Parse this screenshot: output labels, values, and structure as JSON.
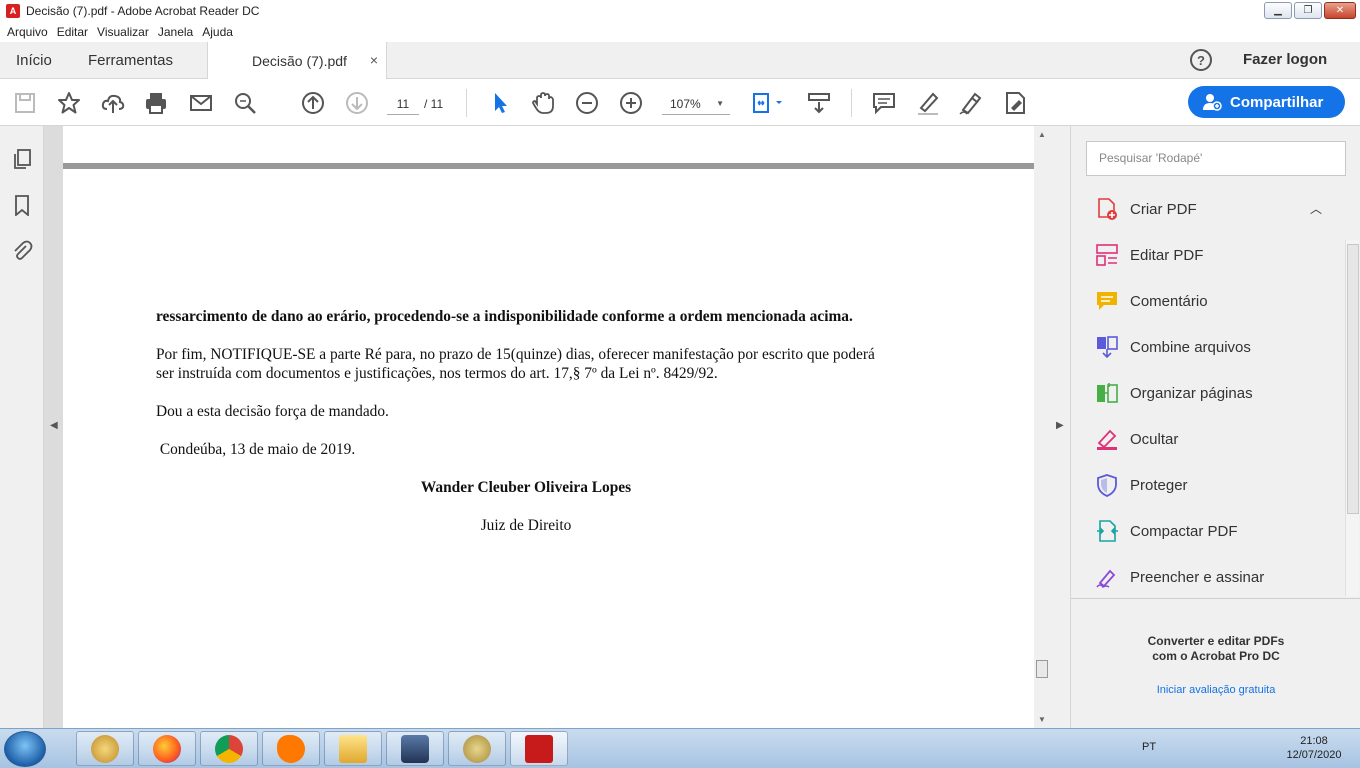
{
  "window": {
    "title": "Decisão (7).pdf - Adobe Acrobat Reader DC",
    "min": "▁",
    "max": "❐",
    "close": "✕"
  },
  "menu": [
    "Arquivo",
    "Editar",
    "Visualizar",
    "Janela",
    "Ajuda"
  ],
  "tabs": {
    "home": "Início",
    "tools": "Ferramentas",
    "doc": "Decisão (7).pdf",
    "close": "×"
  },
  "account": {
    "help": "?",
    "login": "Fazer logon"
  },
  "toolbar": {
    "page_current": "11",
    "page_total": "/ 11",
    "zoom": "107%",
    "share": "Compartilhar"
  },
  "document": {
    "p1": "ressarcimento de dano ao erário, procedendo-se a indisponibilidade conforme a ordem mencionada acima.",
    "p2": "Por fim, NOTIFIQUE-SE a parte Ré para, no prazo de 15(quinze) dias, oferecer manifestação por escrito que poderá ser instruída com documentos e justificações, nos termos do art. 17,§ 7º da Lei nº. 8429/92.",
    "p3": "Dou a esta decisão força de mandado.",
    "p4": " Condeúba, 13 de maio de 2019.",
    "signer": "Wander Cleuber Oliveira Lopes",
    "role": "Juiz de Direito"
  },
  "right_panel": {
    "search_placeholder": "Pesquisar 'Rodapé'",
    "tools": [
      {
        "label": "Criar PDF",
        "icon": "create-pdf-icon",
        "color": "#e03e3e"
      },
      {
        "label": "Editar PDF",
        "icon": "edit-pdf-icon",
        "color": "#e0307a"
      },
      {
        "label": "Comentário",
        "icon": "comment-icon",
        "color": "#f0b400"
      },
      {
        "label": "Combine arquivos",
        "icon": "combine-files-icon",
        "color": "#5a5adb"
      },
      {
        "label": "Organizar páginas",
        "icon": "organize-pages-icon",
        "color": "#46b046"
      },
      {
        "label": "Ocultar",
        "icon": "redact-icon",
        "color": "#e0307a"
      },
      {
        "label": "Proteger",
        "icon": "protect-icon",
        "color": "#5a5adb"
      },
      {
        "label": "Compactar PDF",
        "icon": "compress-pdf-icon",
        "color": "#1aa3a3"
      },
      {
        "label": "Preencher e assinar",
        "icon": "fill-sign-icon",
        "color": "#8a4cd6"
      }
    ],
    "promo_line1": "Converter e editar PDFs",
    "promo_line2": "com o Acrobat Pro DC",
    "trial": "Iniciar avaliação gratuita"
  },
  "taskbar": {
    "lang": "PT",
    "time": "21:08",
    "date": "12/07/2020"
  }
}
